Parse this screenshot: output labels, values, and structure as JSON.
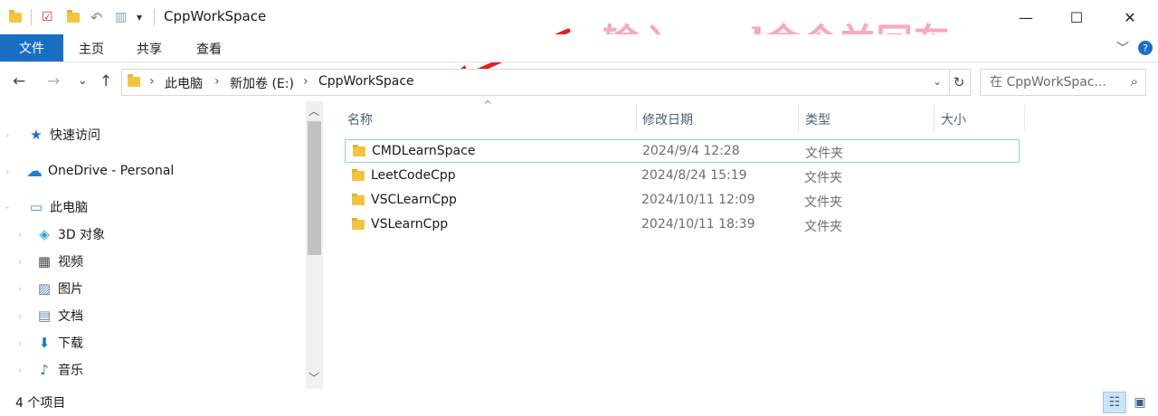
{
  "window": {
    "title": "CppWorkSpace",
    "minimize": "—",
    "maximize": "☐",
    "close": "✕"
  },
  "annotation": {
    "text": "输入cmd命令并回车",
    "color": "#f8a8c0"
  },
  "quick_access_toolbar": {
    "dropdown": "▾"
  },
  "ribbon": {
    "tabs": [
      "文件",
      "主页",
      "共享",
      "查看"
    ],
    "expand": "﹀",
    "help": "?",
    "accent": "#1a6fc4"
  },
  "address": {
    "back": "←",
    "forward": "→",
    "recent": "⌄",
    "up": "↑",
    "breadcrumb": [
      "此电脑",
      "新加卷 (E:)",
      "CppWorkSpace"
    ],
    "sep": "›",
    "dropdown": "⌄",
    "refresh": "↻",
    "search_placeholder": "在 CppWorkSpac...",
    "search_icon": "⌕"
  },
  "nav_pane": {
    "items": [
      {
        "label": "快速访问",
        "icon": "star-icon",
        "glyph": "★"
      },
      {
        "label": "OneDrive - Personal",
        "icon": "cloud-icon",
        "glyph": "☁"
      },
      {
        "label": "此电脑",
        "icon": "computer-icon",
        "glyph": "▭"
      },
      {
        "label": "3D 对象",
        "icon": "cube-icon",
        "glyph": "◈"
      },
      {
        "label": "视频",
        "icon": "film-icon",
        "glyph": "▦"
      },
      {
        "label": "图片",
        "icon": "picture-icon",
        "glyph": "▨"
      },
      {
        "label": "文档",
        "icon": "document-icon",
        "glyph": "▤"
      },
      {
        "label": "下载",
        "icon": "download-icon",
        "glyph": "⬇"
      },
      {
        "label": "音乐",
        "icon": "music-icon",
        "glyph": "♪"
      }
    ],
    "chevron": "›"
  },
  "columns": {
    "name": "名称",
    "date": "修改日期",
    "type": "类型",
    "size": "大小",
    "sort_caret": "^"
  },
  "files": [
    {
      "name": "CMDLearnSpace",
      "date": "2024/9/4 12:28",
      "type": "文件夹"
    },
    {
      "name": "LeetCodeCpp",
      "date": "2024/8/24 15:19",
      "type": "文件夹"
    },
    {
      "name": "VSCLearnCpp",
      "date": "2024/10/11 12:09",
      "type": "文件夹"
    },
    {
      "name": "VSLearnCpp",
      "date": "2024/10/11 18:39",
      "type": "文件夹"
    }
  ],
  "status": {
    "item_count": "4 个项目",
    "details_view": "☷",
    "thumb_view": "▣"
  }
}
